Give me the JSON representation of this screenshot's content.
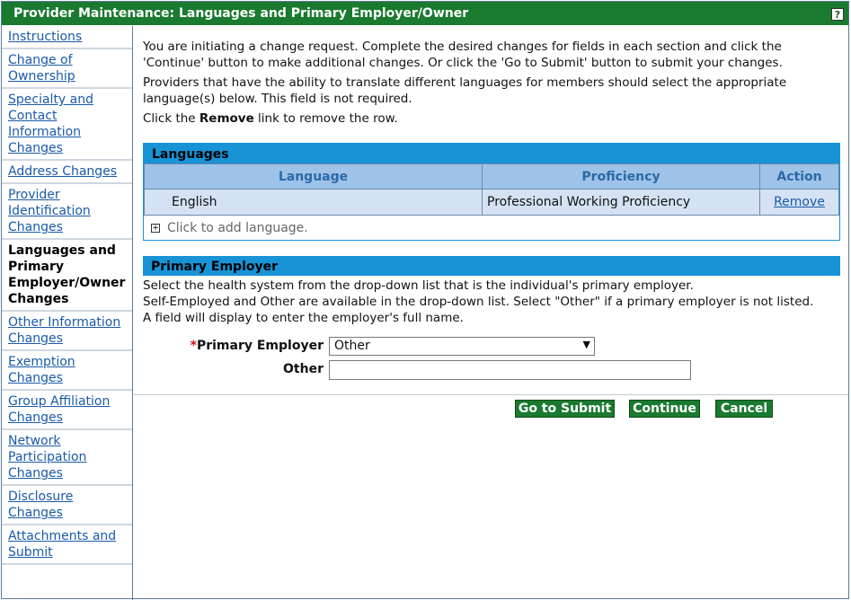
{
  "window": {
    "title": "Provider Maintenance: Languages and Primary Employer/Owner",
    "help_label": "?"
  },
  "sidebar": {
    "items": [
      {
        "label": "Instructions",
        "current": false
      },
      {
        "label": "Change of Ownership",
        "current": false
      },
      {
        "label": "Specialty and Contact Information Changes",
        "current": false
      },
      {
        "label": "Address Changes",
        "current": false
      },
      {
        "label": "Provider Identification Changes",
        "current": false
      },
      {
        "label": "Languages and Primary Employer/Owner Changes",
        "current": true
      },
      {
        "label": "Other Information Changes",
        "current": false
      },
      {
        "label": "Exemption Changes",
        "current": false
      },
      {
        "label": "Group Affiliation Changes",
        "current": false
      },
      {
        "label": "Network Participation Changes",
        "current": false
      },
      {
        "label": "Disclosure Changes",
        "current": false
      },
      {
        "label": "Attachments and Submit",
        "current": false
      }
    ]
  },
  "intro": {
    "p1": "You are initiating a change request. Complete the desired changes for fields in each section and click the 'Continue' button to make additional changes. Or click the 'Go to Submit' button to submit your changes.",
    "p2": "Providers that have the ability to translate different languages for members should select the appropriate language(s) below. This field is not required.",
    "p3_prefix": "Click the ",
    "p3_bold": "Remove",
    "p3_suffix": " link to remove the row."
  },
  "languages": {
    "title": "Languages",
    "columns": [
      "Language",
      "Proficiency",
      "Action"
    ],
    "rows": [
      {
        "language": "English",
        "proficiency": "Professional Working Proficiency",
        "action": "Remove"
      }
    ],
    "add_label": "Click to add language."
  },
  "employer": {
    "title": "Primary Employer",
    "line1": "Select the health system from the drop-down list that is the individual's primary employer.",
    "line2": "Self-Employed and Other are available in the drop-down list. Select \"Other\" if a primary employer is not listed.",
    "line3": "A field will display to enter the employer's full name.",
    "required_marker": "*",
    "primary_label": "Primary Employer",
    "primary_value": "Other",
    "other_label": "Other",
    "other_value": ""
  },
  "buttons": {
    "submit": "Go to Submit",
    "continue": "Continue",
    "cancel": "Cancel"
  }
}
